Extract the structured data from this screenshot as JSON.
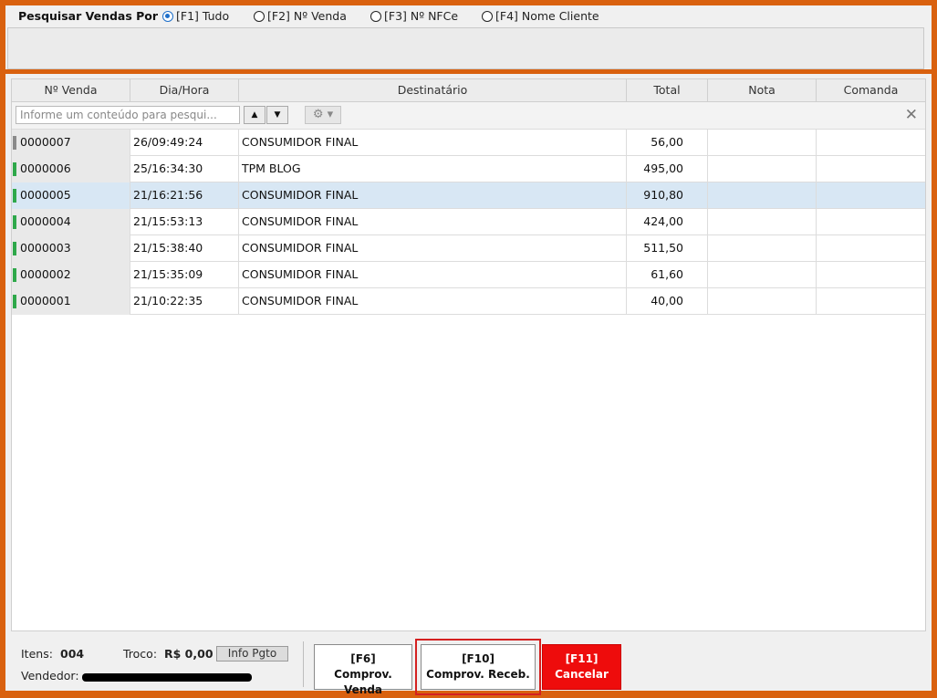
{
  "search": {
    "title": "Pesquisar Vendas Por",
    "options": [
      {
        "label": "[F1] Tudo",
        "selected": true
      },
      {
        "label": "[F2] Nº Venda",
        "selected": false
      },
      {
        "label": "[F3] Nº NFCe",
        "selected": false
      },
      {
        "label": "[F4] Nome Cliente",
        "selected": false
      }
    ]
  },
  "grid": {
    "columns": [
      "Nº Venda",
      "Dia/Hora",
      "Destinatário",
      "Total",
      "Nota",
      "Comanda"
    ],
    "filter_placeholder": "Informe um conteúdo para pesqui...",
    "nav_up": "▲",
    "nav_down": "▼",
    "gear": "⚙ ▾",
    "clear": "✕",
    "rows": [
      {
        "venda": "0000007",
        "dia": "26/09:49:24",
        "dest": "CONSUMIDOR FINAL",
        "total": "56,00",
        "nota": "",
        "comanda": "",
        "status": "gray",
        "selected": false
      },
      {
        "venda": "0000006",
        "dia": "25/16:34:30",
        "dest": "TPM BLOG",
        "total": "495,00",
        "nota": "",
        "comanda": "",
        "status": "green",
        "selected": false
      },
      {
        "venda": "0000005",
        "dia": "21/16:21:56",
        "dest": "CONSUMIDOR FINAL",
        "total": "910,80",
        "nota": "",
        "comanda": "",
        "status": "green",
        "selected": true
      },
      {
        "venda": "0000004",
        "dia": "21/15:53:13",
        "dest": "CONSUMIDOR FINAL",
        "total": "424,00",
        "nota": "",
        "comanda": "",
        "status": "green",
        "selected": false
      },
      {
        "venda": "0000003",
        "dia": "21/15:38:40",
        "dest": "CONSUMIDOR FINAL",
        "total": "511,50",
        "nota": "",
        "comanda": "",
        "status": "green",
        "selected": false
      },
      {
        "venda": "0000002",
        "dia": "21/15:35:09",
        "dest": "CONSUMIDOR FINAL",
        "total": "61,60",
        "nota": "",
        "comanda": "",
        "status": "green",
        "selected": false
      },
      {
        "venda": "0000001",
        "dia": "21/10:22:35",
        "dest": "CONSUMIDOR FINAL",
        "total": "40,00",
        "nota": "",
        "comanda": "",
        "status": "green",
        "selected": false
      }
    ]
  },
  "footer": {
    "itens_label": "Itens:",
    "itens_value": "004",
    "troco_label": "Troco:",
    "troco_value": "R$ 0,00",
    "info_pgto": "Info Pgto",
    "vendedor_label": "Vendedor:",
    "buttons": [
      {
        "key": "[F6]",
        "label": "Comprov. Venda"
      },
      {
        "key": "[F10]",
        "label": "Comprov. Receb."
      },
      {
        "key": "[F11]",
        "label": "Cancelar"
      }
    ]
  },
  "colors": {
    "frame": "#d9610f",
    "accent": "#1e6fc9",
    "cancel": "#ee0c0c",
    "status_green": "#2ea84a",
    "status_gray": "#8a8a8a",
    "selected_row": "#d8e7f4"
  }
}
